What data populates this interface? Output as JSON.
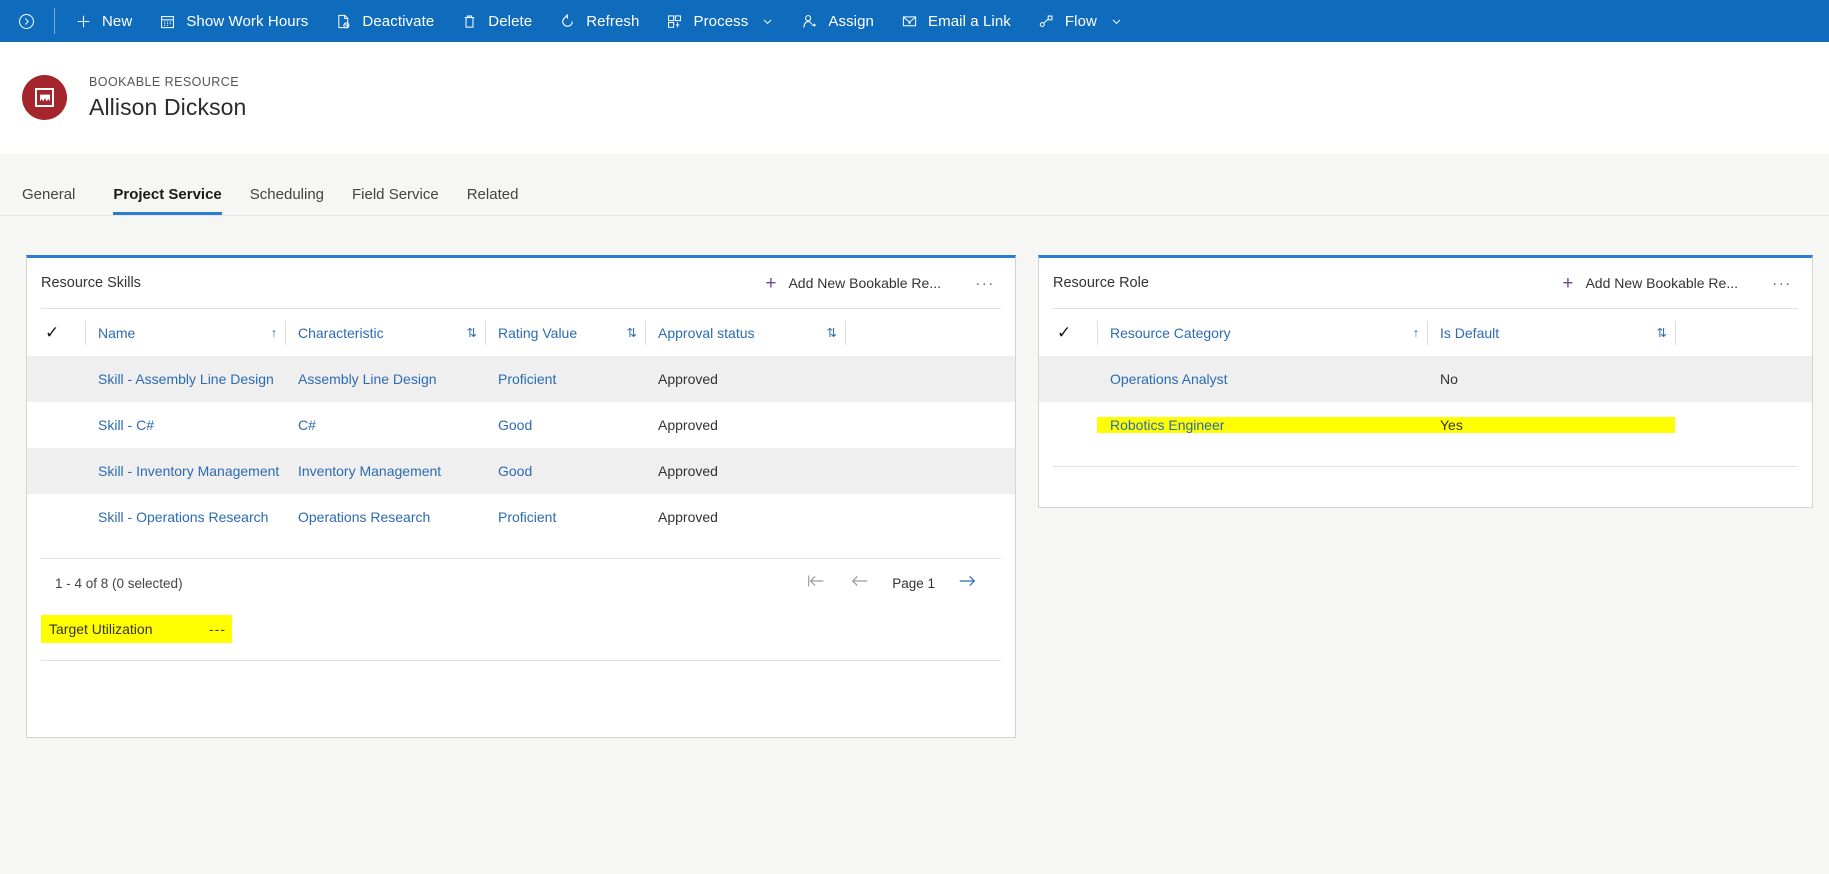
{
  "commandbar": {
    "collapse_icon": "chevron-circle-icon",
    "items": [
      {
        "label": "New",
        "icon": "plus-icon",
        "chevron": false
      },
      {
        "label": "Show Work Hours",
        "icon": "calendar-icon",
        "chevron": false
      },
      {
        "label": "Deactivate",
        "icon": "page-block-icon",
        "chevron": false
      },
      {
        "label": "Delete",
        "icon": "trash-icon",
        "chevron": false
      },
      {
        "label": "Refresh",
        "icon": "refresh-icon",
        "chevron": false
      },
      {
        "label": "Process",
        "icon": "process-icon",
        "chevron": true
      },
      {
        "label": "Assign",
        "icon": "assign-user-icon",
        "chevron": false
      },
      {
        "label": "Email a Link",
        "icon": "email-link-icon",
        "chevron": false
      },
      {
        "label": "Flow",
        "icon": "flow-icon",
        "chevron": true
      }
    ]
  },
  "header": {
    "entity_label": "BOOKABLE RESOURCE",
    "record_name": "Allison Dickson",
    "avatar_icon": "bookable-resource-icon"
  },
  "tabs": [
    {
      "label": "General",
      "active": false
    },
    {
      "label": "Project Service",
      "active": true
    },
    {
      "label": "Scheduling",
      "active": false
    },
    {
      "label": "Field Service",
      "active": false
    },
    {
      "label": "Related",
      "active": false
    }
  ],
  "skills_panel": {
    "title": "Resource Skills",
    "add_label": "Add New Bookable Re...",
    "more_label": "···",
    "columns": [
      {
        "label": "Name",
        "sort": "↑"
      },
      {
        "label": "Characteristic",
        "sort": "⇅"
      },
      {
        "label": "Rating Value",
        "sort": "⇅"
      },
      {
        "label": "Approval status",
        "sort": "⇅"
      }
    ],
    "rows": [
      {
        "name": "Skill - Assembly Line Design",
        "characteristic": "Assembly Line Design",
        "rating": "Proficient",
        "approval": "Approved"
      },
      {
        "name": "Skill - C#",
        "characteristic": "C#",
        "rating": "Good",
        "approval": "Approved"
      },
      {
        "name": "Skill - Inventory Management",
        "characteristic": "Inventory Management",
        "rating": "Good",
        "approval": "Approved"
      },
      {
        "name": "Skill - Operations Research",
        "characteristic": "Operations Research",
        "rating": "Proficient",
        "approval": "Approved"
      }
    ],
    "pager": {
      "count_text": "1 - 4 of 8 (0 selected)",
      "first_icon": "page-first-icon",
      "prev_icon": "page-prev-icon",
      "page_label": "Page 1",
      "next_icon": "page-next-icon"
    },
    "field": {
      "label": "Target Utilization",
      "value": "---",
      "highlight_color": "#ffff00"
    }
  },
  "role_panel": {
    "title": "Resource Role",
    "add_label": "Add New Bookable Re...",
    "more_label": "···",
    "columns": [
      {
        "label": "Resource Category",
        "sort": "↑"
      },
      {
        "label": "Is Default",
        "sort": "⇅"
      }
    ],
    "rows": [
      {
        "category": "Operations Analyst",
        "is_default": "No",
        "highlighted": false
      },
      {
        "category": "Robotics Engineer",
        "is_default": "Yes",
        "highlighted": true
      }
    ],
    "highlight_color": "#ffff00"
  },
  "theme": {
    "command_bar": "#0f6cbd",
    "accent": "#2b7cd3",
    "link": "#2c6bb3",
    "avatar": "#a4262c",
    "page_bg": "#f6f6f5",
    "row_alt": "#efefef",
    "highlight": "#ffff00"
  }
}
